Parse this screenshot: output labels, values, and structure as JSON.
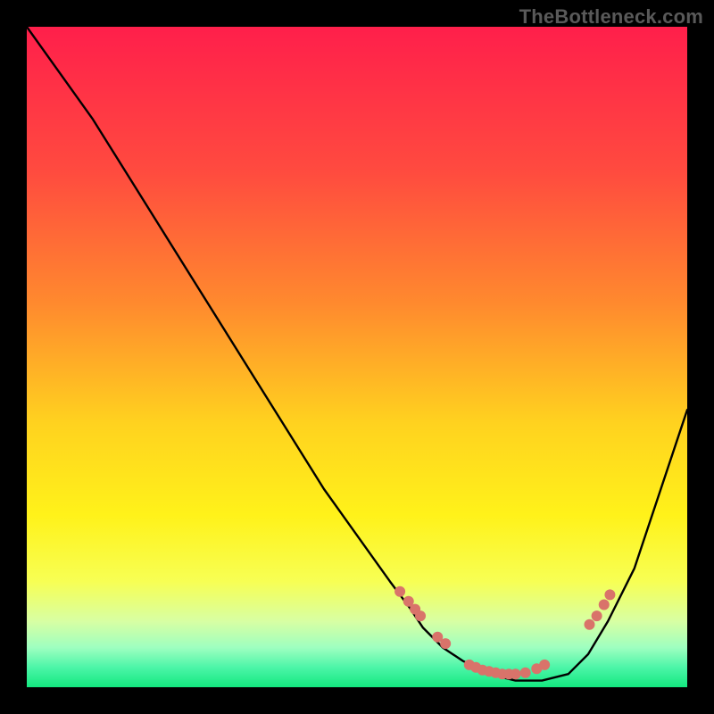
{
  "watermark": "TheBottleneck.com",
  "chart_data": {
    "type": "line",
    "title": "",
    "xlabel": "",
    "ylabel": "",
    "xlim": [
      0,
      100
    ],
    "ylim": [
      0,
      100
    ],
    "series": [
      {
        "name": "bottleneck-curve",
        "x": [
          0,
          5,
          10,
          15,
          20,
          25,
          30,
          35,
          40,
          45,
          50,
          55,
          58,
          60,
          63,
          66,
          70,
          74,
          78,
          82,
          85,
          88,
          92,
          96,
          100
        ],
        "y": [
          100,
          93,
          86,
          78,
          70,
          62,
          54,
          46,
          38,
          30,
          23,
          16,
          12,
          9,
          6,
          4,
          2,
          1,
          1,
          2,
          5,
          10,
          18,
          30,
          42
        ]
      }
    ],
    "highlight_points": {
      "name": "dots",
      "color": "#d9736a",
      "x": [
        56.5,
        57.8,
        58.8,
        59.6,
        62.2,
        63.4,
        67.0,
        68.0,
        69.0,
        70.0,
        71.0,
        72.0,
        73.0,
        74.0,
        75.5,
        77.2,
        78.4,
        85.2,
        86.3,
        87.4,
        88.3
      ],
      "y": [
        14.5,
        13.0,
        11.8,
        10.8,
        7.6,
        6.6,
        3.4,
        3.0,
        2.6,
        2.4,
        2.2,
        2.0,
        2.0,
        2.0,
        2.2,
        2.8,
        3.4,
        9.5,
        10.8,
        12.5,
        14.0
      ]
    },
    "gradient_stops": [
      {
        "offset": 0.0,
        "color": "#ff1f4b"
      },
      {
        "offset": 0.22,
        "color": "#ff4b3f"
      },
      {
        "offset": 0.42,
        "color": "#ff8a2e"
      },
      {
        "offset": 0.6,
        "color": "#ffd21f"
      },
      {
        "offset": 0.74,
        "color": "#fff21a"
      },
      {
        "offset": 0.84,
        "color": "#f7ff54"
      },
      {
        "offset": 0.9,
        "color": "#d8ffa3"
      },
      {
        "offset": 0.94,
        "color": "#9effc0"
      },
      {
        "offset": 0.97,
        "color": "#4cf5a8"
      },
      {
        "offset": 1.0,
        "color": "#13e87f"
      }
    ]
  }
}
